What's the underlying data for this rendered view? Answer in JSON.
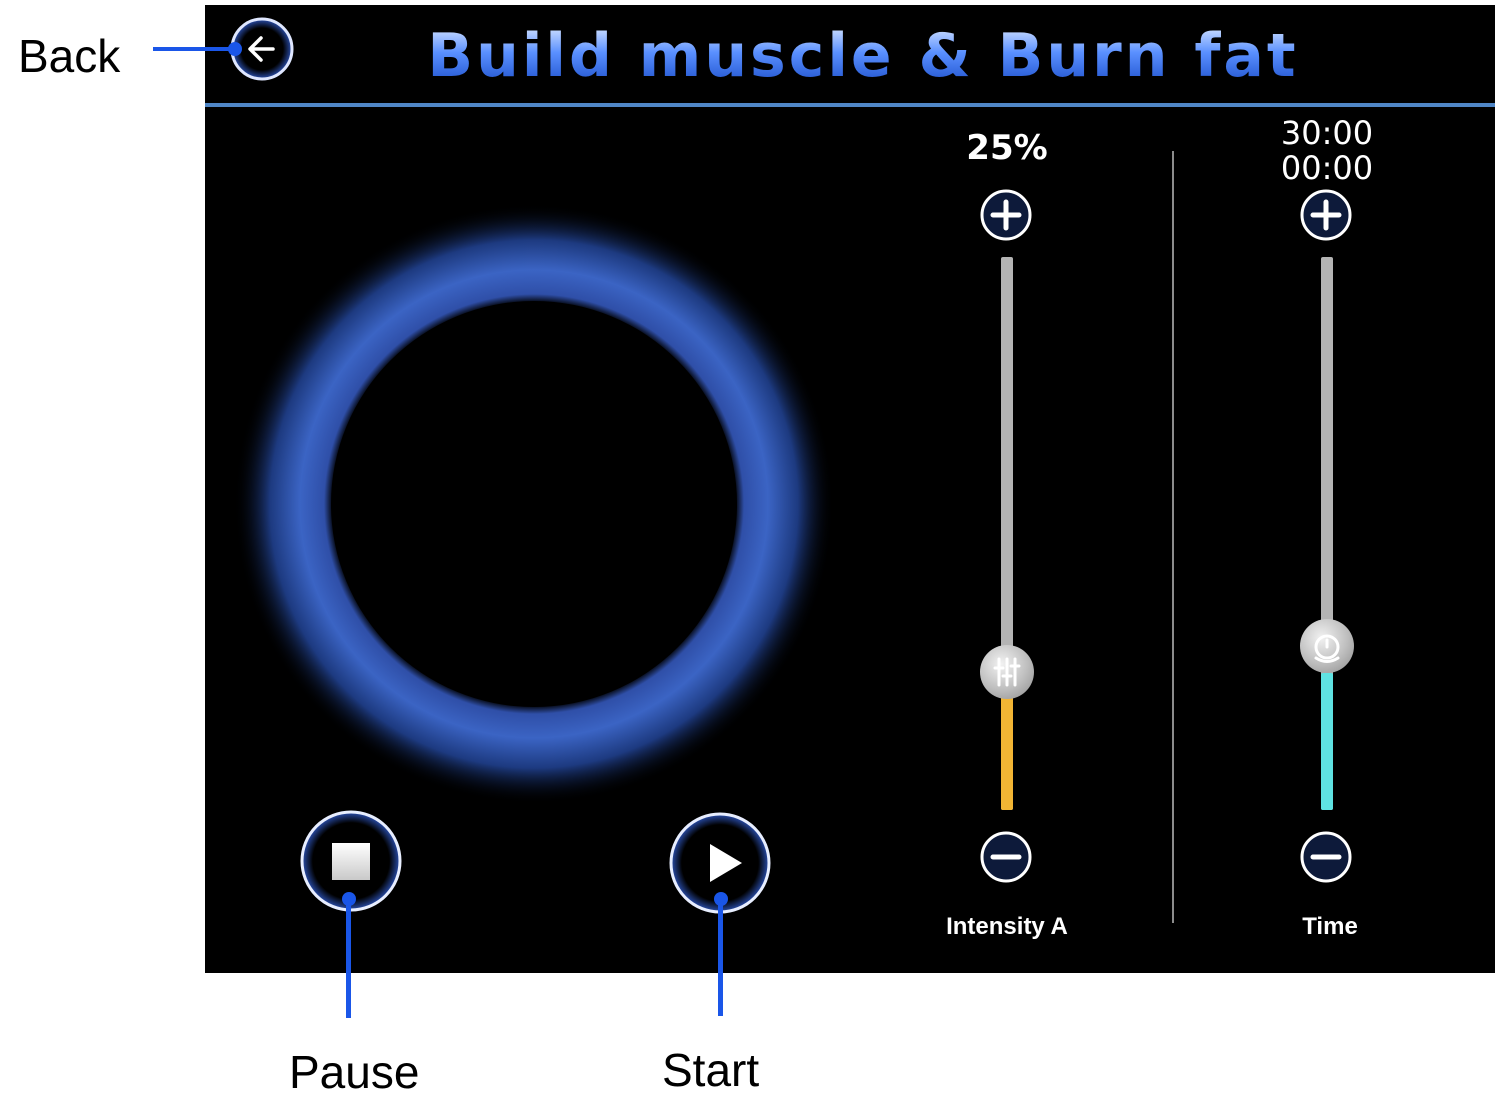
{
  "annotations": {
    "back": "Back",
    "pause": "Pause",
    "start": "Start"
  },
  "header": {
    "title": "Build muscle & Burn fat",
    "back_icon": "arrow-left-circle-icon"
  },
  "controls": {
    "stop_icon": "stop-icon",
    "play_icon": "play-icon"
  },
  "intensity": {
    "value": "25%",
    "label": "Intensity A",
    "level_fraction": 0.25,
    "fill_color": "#f2b534",
    "plus_icon": "plus-circle-icon",
    "minus_icon": "minus-circle-icon",
    "thumb_icon": "sliders-icon"
  },
  "time": {
    "total": "30:00",
    "elapsed": "00:00",
    "label": "Time",
    "fill_color": "#5fe3e3",
    "plus_icon": "plus-circle-icon",
    "minus_icon": "minus-circle-icon",
    "thumb_icon": "timer-icon"
  },
  "colors": {
    "accent": "#4f86c6",
    "callout": "#1a56e8",
    "track": "#b4b4b4"
  }
}
